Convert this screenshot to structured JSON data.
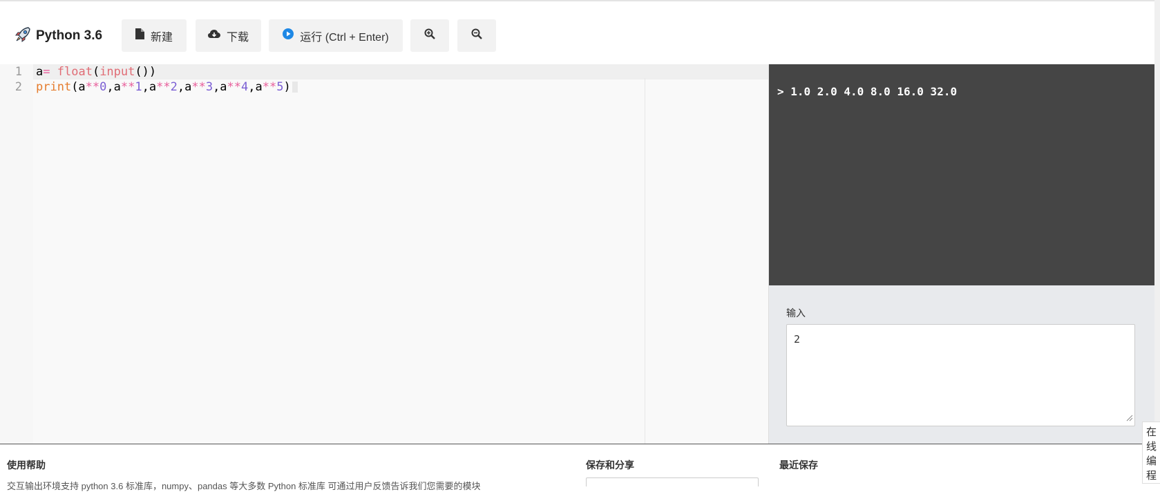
{
  "app": {
    "title": "Python 3.6"
  },
  "toolbar": {
    "new_label": "新建",
    "download_label": "下载",
    "run_label": "运行 (Ctrl + Enter)"
  },
  "editor": {
    "line_numbers": [
      "1",
      "2"
    ]
  },
  "output": {
    "text": "> 1.0 2.0 4.0 8.0 16.0 32.0"
  },
  "input": {
    "label": "输入",
    "value": "2"
  },
  "footer": {
    "help_title": "使用帮助",
    "help_text": "交互输出环境支持 python 3.6 标准库，numpy、pandas 等大多数 Python 标准库 可通过用户反馈告诉我们您需要的模块",
    "share_title": "保存和分享",
    "recent_title": "最近保存"
  },
  "sidetab": {
    "label": "在线编程"
  },
  "colors": {
    "output_bg": "#454545",
    "input_bg": "#e8eaed",
    "run_icon": "#1e88e5"
  }
}
